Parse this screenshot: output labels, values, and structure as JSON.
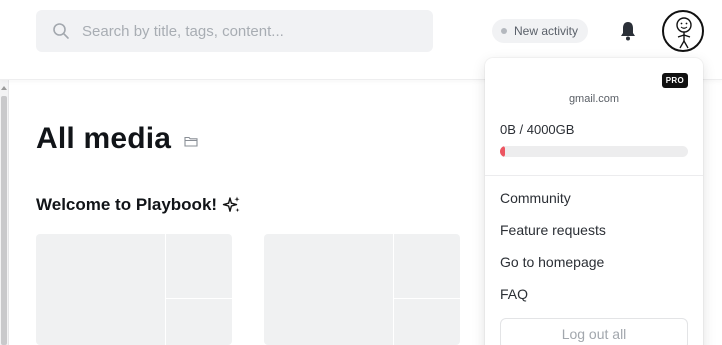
{
  "header": {
    "search": {
      "placeholder": "Search by title, tags, content...",
      "value": ""
    },
    "activity_label": "New activity",
    "icons": {
      "search": "search-icon",
      "bell": "bell-icon",
      "avatar": "stick-figure-avatar"
    }
  },
  "main": {
    "title": "All media",
    "section_title": "Welcome to Playbook!",
    "icons": {
      "folder": "folder-icon",
      "sparkle": "sparkle-icon"
    }
  },
  "account_menu": {
    "badge": "PRO",
    "email": "gmail.com",
    "storage": {
      "label": "0B / 4000GB",
      "used_fraction": 0.0
    },
    "items": [
      {
        "label": "Community"
      },
      {
        "label": "Feature requests"
      },
      {
        "label": "Go to homepage"
      },
      {
        "label": "FAQ"
      }
    ],
    "logout_label": "Log out all"
  },
  "colors": {
    "accent": "#ec5561",
    "surface": "#f1f2f4",
    "text": "#111418"
  }
}
